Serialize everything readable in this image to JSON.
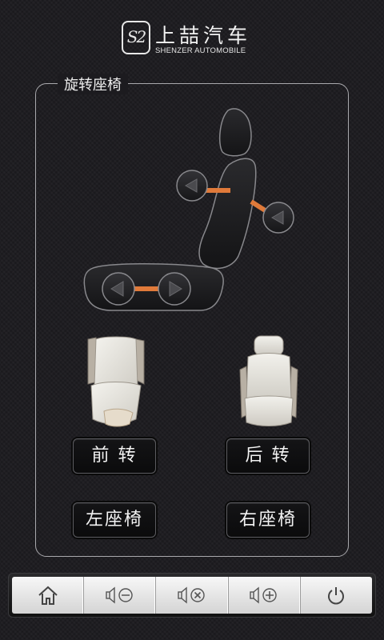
{
  "header": {
    "logo_mark": "S2",
    "brand_cn": "上喆汽车",
    "brand_en": "SHENZER AUTOMOBILE"
  },
  "panel": {
    "title": "旋转座椅"
  },
  "diagram": {
    "icons": [
      "headrest-icon",
      "backrest-icon",
      "cushion-icon",
      "arrow-left-icon",
      "arrow-right-icon"
    ],
    "accent_color": "#e07a3a"
  },
  "buttons": {
    "front_rotate": "前 转",
    "rear_rotate": "后 转",
    "left_seat": "左座椅",
    "right_seat": "右座椅"
  },
  "bottom_bar": {
    "items": [
      "home-icon",
      "volume-down-icon",
      "volume-mute-icon",
      "volume-up-icon",
      "power-icon"
    ]
  }
}
